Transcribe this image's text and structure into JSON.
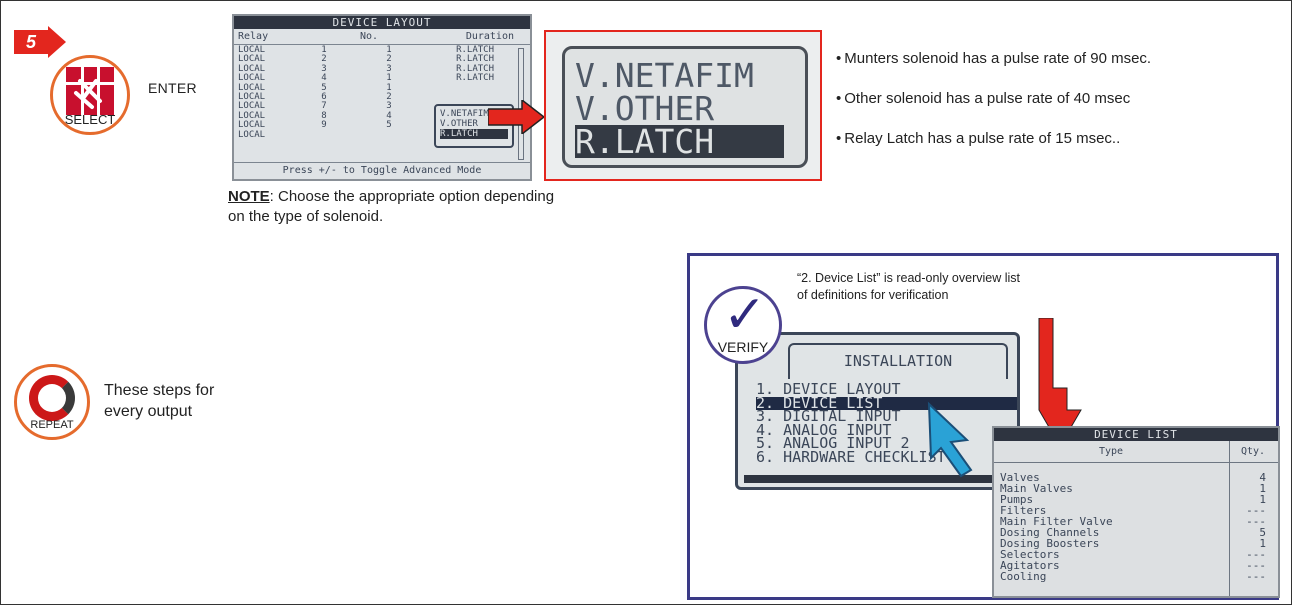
{
  "step": {
    "number": "5"
  },
  "select_icon": {
    "label": "SELECT"
  },
  "enter_label": "ENTER",
  "device_layout_screen": {
    "title": "DEVICE LAYOUT",
    "columns": [
      "Relay",
      "No.",
      "Duration"
    ],
    "rows": [
      {
        "relay": "LOCAL",
        "no1": "1",
        "no2": "1",
        "duration": "R.LATCH"
      },
      {
        "relay": "LOCAL",
        "no1": "2",
        "no2": "2",
        "duration": "R.LATCH"
      },
      {
        "relay": "LOCAL",
        "no1": "3",
        "no2": "3",
        "duration": "R.LATCH"
      },
      {
        "relay": "LOCAL",
        "no1": "4",
        "no2": "1",
        "duration": "R.LATCH"
      },
      {
        "relay": "LOCAL",
        "no1": "5",
        "no2": "1",
        "duration": ""
      },
      {
        "relay": "LOCAL",
        "no1": "6",
        "no2": "2",
        "duration": ""
      },
      {
        "relay": "LOCAL",
        "no1": "7",
        "no2": "3",
        "duration": ""
      },
      {
        "relay": "LOCAL",
        "no1": "8",
        "no2": "4",
        "duration": ""
      },
      {
        "relay": "LOCAL",
        "no1": "9",
        "no2": "5",
        "duration": ""
      },
      {
        "relay": "LOCAL",
        "no1": "",
        "no2": "",
        "duration": ""
      }
    ],
    "popup": [
      "V.NETAFIM",
      "V.OTHER",
      "R.LATCH"
    ],
    "footer": "Press +/- to Toggle Advanced Mode"
  },
  "zoomed_popup": [
    "V.NETAFIM",
    "V.OTHER",
    "R.LATCH"
  ],
  "bullets": [
    "Munters solenoid has a pulse rate of 90 msec.",
    "Other solenoid has a pulse rate of 40 msec",
    "Relay Latch has a pulse rate of 15 msec.."
  ],
  "note": {
    "keyword": "NOTE",
    "text": ": Choose the appropriate option depending on the type of solenoid."
  },
  "repeat_icon": {
    "label": "REPEAT"
  },
  "repeat_text": "These steps for every output",
  "verify_icon": {
    "label": "VERIFY"
  },
  "verify_text": "“2. Device List” is read-only overview list of definitions for verification",
  "installation_screen": {
    "title": "INSTALLATION",
    "items": [
      "1. DEVICE LAYOUT",
      "2. DEVICE LIST",
      "3. DIGITAL INPUT",
      "4. ANALOG INPUT",
      "5. ANALOG INPUT 2",
      "6. HARDWARE CHECKLIST"
    ],
    "selected_index": 1
  },
  "device_list_screen": {
    "title": "DEVICE LIST",
    "columns": [
      "Type",
      "Qty."
    ],
    "rows": [
      {
        "type": "Valves",
        "qty": "4"
      },
      {
        "type": "Main Valves",
        "qty": "1"
      },
      {
        "type": "Pumps",
        "qty": "1"
      },
      {
        "type": "Filters",
        "qty": "---"
      },
      {
        "type": "Main Filter Valve",
        "qty": "---"
      },
      {
        "type": "Dosing Channels",
        "qty": "5"
      },
      {
        "type": "Dosing Boosters",
        "qty": "1"
      },
      {
        "type": "Selectors",
        "qty": "---"
      },
      {
        "type": "Agitators",
        "qty": "---"
      },
      {
        "type": "Cooling",
        "qty": "---"
      }
    ]
  },
  "colors": {
    "accent_red": "#e3261e",
    "verify_border": "#3a3a86",
    "cursor_blue": "#2aa2d6"
  }
}
